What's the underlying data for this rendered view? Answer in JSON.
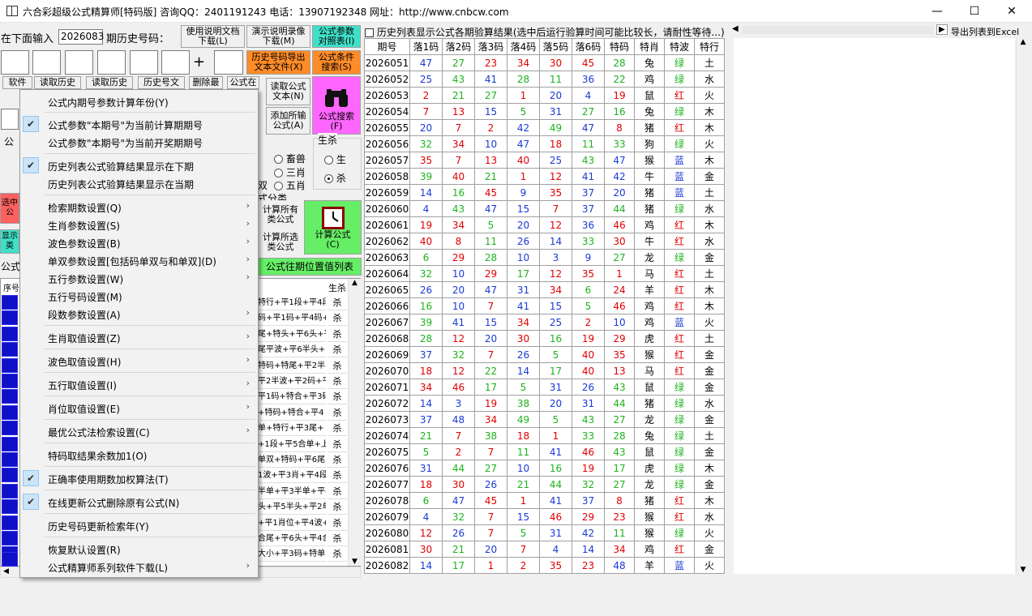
{
  "window": {
    "title": "六合彩超级公式精算师[特码版]  咨询QQ：2401191243 电话：13907192348 网址：http://www.cnbcw.com",
    "minimize": "—",
    "maximize": "☐",
    "close": "✕"
  },
  "toolbar": {
    "input_label": "在下面输入",
    "issue_value": "2026083",
    "history_label": "期历史号码：",
    "plus": "+",
    "btn_manual": "使用说明文档\n下载(L)",
    "btn_video": "演示说明录像\n下载(M)",
    "btn_compare": "公式参数\n对照表(I)",
    "btn_export_text": "历史号码导出\n文本文件(X)",
    "btn_cond_search": "公式条件\n搜索(S)",
    "btn_read_formula": "读取公式\n文本(N)",
    "btn_add_all": "添加所输\n公式(A)",
    "btn_formula_search": "公式搜索\n(F)",
    "tab_software": "软件",
    "tab_read_history": "读取历史",
    "tab_read_history2": "读取历史",
    "tab_history_text": "历史号文",
    "tab_delete": "删除最",
    "tab_formula": "公式在"
  },
  "left": {
    "shengxiao_label": "生杀",
    "radio_sheng": "生",
    "radio_sha": "杀",
    "opt_chuzhu": "畜兽",
    "opt_sanxiao": "三肖",
    "opt_wuxiao": "五肖",
    "shuang": "双",
    "formula_class": "式分类",
    "btn_calc_all": "计算所有\n类公式",
    "btn_calc_sel": "计算所选\n类公式",
    "btn_calc": "计算公式\n(C)",
    "btn_position": "公式往期位置值列表",
    "xuhao": "序号",
    "shengsha": "生杀",
    "partial_a": "公",
    "partial_b": "选中\n公",
    "partial_c": "显示\n类",
    "partial_d": "公式",
    "rows": [
      "特行+平1段+平4段",
      "码+平1码+平4码+",
      "尾+特头+平6头+平",
      "尾平波+平6半头+",
      "特码+特尾+平2半",
      "平2半波+平2码+平",
      "平1码+特合+平3码",
      "+特码+特合+平4",
      "单+特行+平3尾+",
      "+1段+平5合单+上",
      "单双+特码+平6尾",
      "1波+平3肖+平4段",
      "半单+平3半单+平4",
      "头+平5半头+平2单",
      "+平1肖位+平4波+",
      "合尾+平6头+平4合",
      "大小+平3码+特单"
    ],
    "row_mark": "杀"
  },
  "right": {
    "checkbox_label": "历史列表显示公式各期验算结果(选中后运行验算时间可能比较长，请耐性等待...)",
    "export_excel": "导出列表到Excel"
  },
  "menu": {
    "items": [
      {
        "label": "公式内期号参数计算年份(Y)",
        "checked": false,
        "sub": false
      },
      {
        "label": "公式参数\"本期号\"为当前计算期期号",
        "checked": true,
        "sub": false
      },
      {
        "label": "公式参数\"本期号\"为当前开奖期期号",
        "checked": false,
        "sub": false
      },
      {
        "label": "历史列表公式验算结果显示在下期",
        "checked": true,
        "sub": false
      },
      {
        "label": "历史列表公式验算结果显示在当期",
        "checked": false,
        "sub": false
      },
      {
        "label": "检索期数设置(Q)",
        "checked": false,
        "sub": true
      },
      {
        "label": "生肖参数设置(S)",
        "checked": false,
        "sub": true
      },
      {
        "label": "波色参数设置(B)",
        "checked": false,
        "sub": true
      },
      {
        "label": "单双参数设置[包括码单双与和单双](D)",
        "checked": false,
        "sub": true
      },
      {
        "label": "五行参数设置(W)",
        "checked": false,
        "sub": true
      },
      {
        "label": "五行号码设置(M)",
        "checked": false,
        "sub": false
      },
      {
        "label": "段数参数设置(A)",
        "checked": false,
        "sub": true
      },
      {
        "label": "生肖取值设置(Z)",
        "checked": false,
        "sub": true
      },
      {
        "label": "波色取值设置(H)",
        "checked": false,
        "sub": true
      },
      {
        "label": "五行取值设置(I)",
        "checked": false,
        "sub": true
      },
      {
        "label": "肖位取值设置(E)",
        "checked": false,
        "sub": true
      },
      {
        "label": "最优公式法检索设置(C)",
        "checked": false,
        "sub": true
      },
      {
        "label": "特码取结果余数加1(O)",
        "checked": false,
        "sub": false
      },
      {
        "label": "正确率使用期数加权算法(T)",
        "checked": true,
        "sub": false
      },
      {
        "label": "在线更新公式删除原有公式(N)",
        "checked": true,
        "sub": false
      },
      {
        "label": "历史号码更新检索年(Y)",
        "checked": false,
        "sub": false
      },
      {
        "label": "恢复默认设置(R)",
        "checked": false,
        "sub": false
      },
      {
        "label": "公式精算师系列软件下载(L)",
        "checked": false,
        "sub": true
      }
    ]
  },
  "table": {
    "headers": [
      "期号",
      "落1码",
      "落2码",
      "落3码",
      "落4码",
      "落5码",
      "落6码",
      "特码",
      "特肖",
      "特波",
      "特行"
    ],
    "colors": {
      "red": "#e00000",
      "green": "#1db31d",
      "blue": "#1a3ad6"
    },
    "rows": [
      [
        "2026051",
        [
          47,
          "b"
        ],
        [
          27,
          "g"
        ],
        [
          23,
          "r"
        ],
        [
          34,
          "r"
        ],
        [
          30,
          "r"
        ],
        [
          45,
          "r"
        ],
        [
          28,
          "g"
        ],
        "兔",
        [
          "绿",
          "g"
        ],
        "土"
      ],
      [
        "2026052",
        [
          25,
          "b"
        ],
        [
          43,
          "g"
        ],
        [
          41,
          "b"
        ],
        [
          28,
          "g"
        ],
        [
          11,
          "g"
        ],
        [
          36,
          "b"
        ],
        [
          22,
          "g"
        ],
        "鸡",
        [
          "绿",
          "g"
        ],
        "水"
      ],
      [
        "2026053",
        [
          2,
          "r"
        ],
        [
          21,
          "g"
        ],
        [
          27,
          "g"
        ],
        [
          1,
          "r"
        ],
        [
          20,
          "b"
        ],
        [
          4,
          "b"
        ],
        [
          19,
          "r"
        ],
        "鼠",
        [
          "红",
          "r"
        ],
        "火"
      ],
      [
        "2026054",
        [
          7,
          "r"
        ],
        [
          13,
          "r"
        ],
        [
          15,
          "b"
        ],
        [
          5,
          "g"
        ],
        [
          31,
          "b"
        ],
        [
          27,
          "g"
        ],
        [
          16,
          "g"
        ],
        "兔",
        [
          "绿",
          "g"
        ],
        "木"
      ],
      [
        "2026055",
        [
          20,
          "b"
        ],
        [
          7,
          "r"
        ],
        [
          2,
          "r"
        ],
        [
          42,
          "b"
        ],
        [
          49,
          "g"
        ],
        [
          47,
          "b"
        ],
        [
          8,
          "r"
        ],
        "猪",
        [
          "红",
          "r"
        ],
        "木"
      ],
      [
        "2026056",
        [
          32,
          "g"
        ],
        [
          34,
          "r"
        ],
        [
          10,
          "b"
        ],
        [
          47,
          "b"
        ],
        [
          18,
          "r"
        ],
        [
          11,
          "g"
        ],
        [
          33,
          "g"
        ],
        "狗",
        [
          "绿",
          "g"
        ],
        "火"
      ],
      [
        "2026057",
        [
          35,
          "r"
        ],
        [
          7,
          "r"
        ],
        [
          13,
          "r"
        ],
        [
          40,
          "r"
        ],
        [
          25,
          "b"
        ],
        [
          43,
          "g"
        ],
        [
          47,
          "b"
        ],
        "猴",
        [
          "蓝",
          "b"
        ],
        "木"
      ],
      [
        "2026058",
        [
          39,
          "g"
        ],
        [
          40,
          "r"
        ],
        [
          21,
          "g"
        ],
        [
          1,
          "r"
        ],
        [
          12,
          "r"
        ],
        [
          41,
          "b"
        ],
        [
          42,
          "b"
        ],
        "牛",
        [
          "蓝",
          "b"
        ],
        "金"
      ],
      [
        "2026059",
        [
          14,
          "b"
        ],
        [
          16,
          "g"
        ],
        [
          45,
          "r"
        ],
        [
          9,
          "b"
        ],
        [
          35,
          "r"
        ],
        [
          37,
          "b"
        ],
        [
          20,
          "b"
        ],
        "猪",
        [
          "蓝",
          "b"
        ],
        "土"
      ],
      [
        "2026060",
        [
          4,
          "b"
        ],
        [
          43,
          "g"
        ],
        [
          47,
          "b"
        ],
        [
          15,
          "b"
        ],
        [
          7,
          "r"
        ],
        [
          37,
          "b"
        ],
        [
          44,
          "g"
        ],
        "猪",
        [
          "绿",
          "g"
        ],
        "水"
      ],
      [
        "2026061",
        [
          19,
          "r"
        ],
        [
          34,
          "r"
        ],
        [
          5,
          "g"
        ],
        [
          20,
          "b"
        ],
        [
          12,
          "r"
        ],
        [
          36,
          "b"
        ],
        [
          46,
          "r"
        ],
        "鸡",
        [
          "红",
          "r"
        ],
        "木"
      ],
      [
        "2026062",
        [
          40,
          "r"
        ],
        [
          8,
          "r"
        ],
        [
          11,
          "g"
        ],
        [
          26,
          "b"
        ],
        [
          14,
          "b"
        ],
        [
          33,
          "g"
        ],
        [
          30,
          "r"
        ],
        "牛",
        [
          "红",
          "r"
        ],
        "水"
      ],
      [
        "2026063",
        [
          6,
          "g"
        ],
        [
          29,
          "r"
        ],
        [
          28,
          "g"
        ],
        [
          10,
          "b"
        ],
        [
          3,
          "b"
        ],
        [
          9,
          "b"
        ],
        [
          27,
          "g"
        ],
        "龙",
        [
          "绿",
          "g"
        ],
        "金"
      ],
      [
        "2026064",
        [
          32,
          "g"
        ],
        [
          10,
          "b"
        ],
        [
          29,
          "r"
        ],
        [
          17,
          "g"
        ],
        [
          12,
          "r"
        ],
        [
          35,
          "r"
        ],
        [
          1,
          "r"
        ],
        "马",
        [
          "红",
          "r"
        ],
        "土"
      ],
      [
        "2026065",
        [
          26,
          "b"
        ],
        [
          20,
          "b"
        ],
        [
          47,
          "b"
        ],
        [
          31,
          "b"
        ],
        [
          34,
          "r"
        ],
        [
          6,
          "g"
        ],
        [
          24,
          "r"
        ],
        "羊",
        [
          "红",
          "r"
        ],
        "木"
      ],
      [
        "2026066",
        [
          16,
          "g"
        ],
        [
          10,
          "b"
        ],
        [
          7,
          "r"
        ],
        [
          41,
          "b"
        ],
        [
          15,
          "b"
        ],
        [
          5,
          "g"
        ],
        [
          46,
          "r"
        ],
        "鸡",
        [
          "红",
          "r"
        ],
        "木"
      ],
      [
        "2026067",
        [
          39,
          "g"
        ],
        [
          41,
          "b"
        ],
        [
          15,
          "b"
        ],
        [
          34,
          "r"
        ],
        [
          25,
          "b"
        ],
        [
          2,
          "r"
        ],
        [
          10,
          "b"
        ],
        "鸡",
        [
          "蓝",
          "b"
        ],
        "火"
      ],
      [
        "2026068",
        [
          28,
          "g"
        ],
        [
          12,
          "r"
        ],
        [
          20,
          "b"
        ],
        [
          30,
          "r"
        ],
        [
          16,
          "g"
        ],
        [
          19,
          "r"
        ],
        [
          29,
          "r"
        ],
        "虎",
        [
          "红",
          "r"
        ],
        "土"
      ],
      [
        "2026069",
        [
          37,
          "b"
        ],
        [
          32,
          "g"
        ],
        [
          7,
          "r"
        ],
        [
          26,
          "b"
        ],
        [
          5,
          "g"
        ],
        [
          40,
          "r"
        ],
        [
          35,
          "r"
        ],
        "猴",
        [
          "红",
          "r"
        ],
        "金"
      ],
      [
        "2026070",
        [
          18,
          "r"
        ],
        [
          12,
          "r"
        ],
        [
          22,
          "g"
        ],
        [
          14,
          "b"
        ],
        [
          17,
          "g"
        ],
        [
          40,
          "r"
        ],
        [
          13,
          "r"
        ],
        "马",
        [
          "红",
          "r"
        ],
        "金"
      ],
      [
        "2026071",
        [
          34,
          "r"
        ],
        [
          46,
          "r"
        ],
        [
          17,
          "g"
        ],
        [
          5,
          "g"
        ],
        [
          31,
          "b"
        ],
        [
          26,
          "b"
        ],
        [
          43,
          "g"
        ],
        "鼠",
        [
          "绿",
          "g"
        ],
        "金"
      ],
      [
        "2026072",
        [
          14,
          "b"
        ],
        [
          3,
          "b"
        ],
        [
          19,
          "r"
        ],
        [
          38,
          "g"
        ],
        [
          20,
          "b"
        ],
        [
          31,
          "b"
        ],
        [
          44,
          "g"
        ],
        "猪",
        [
          "绿",
          "g"
        ],
        "水"
      ],
      [
        "2026073",
        [
          37,
          "b"
        ],
        [
          48,
          "b"
        ],
        [
          34,
          "r"
        ],
        [
          49,
          "g"
        ],
        [
          5,
          "g"
        ],
        [
          43,
          "g"
        ],
        [
          27,
          "g"
        ],
        "龙",
        [
          "绿",
          "g"
        ],
        "金"
      ],
      [
        "2026074",
        [
          21,
          "g"
        ],
        [
          7,
          "r"
        ],
        [
          38,
          "g"
        ],
        [
          18,
          "r"
        ],
        [
          1,
          "r"
        ],
        [
          33,
          "g"
        ],
        [
          28,
          "g"
        ],
        "兔",
        [
          "绿",
          "g"
        ],
        "土"
      ],
      [
        "2026075",
        [
          5,
          "g"
        ],
        [
          2,
          "r"
        ],
        [
          7,
          "r"
        ],
        [
          11,
          "g"
        ],
        [
          41,
          "b"
        ],
        [
          46,
          "r"
        ],
        [
          43,
          "g"
        ],
        "鼠",
        [
          "绿",
          "g"
        ],
        "金"
      ],
      [
        "2026076",
        [
          31,
          "b"
        ],
        [
          44,
          "g"
        ],
        [
          27,
          "g"
        ],
        [
          10,
          "b"
        ],
        [
          16,
          "g"
        ],
        [
          19,
          "r"
        ],
        [
          17,
          "g"
        ],
        "虎",
        [
          "绿",
          "g"
        ],
        "木"
      ],
      [
        "2026077",
        [
          18,
          "r"
        ],
        [
          30,
          "r"
        ],
        [
          26,
          "b"
        ],
        [
          21,
          "g"
        ],
        [
          44,
          "g"
        ],
        [
          32,
          "g"
        ],
        [
          27,
          "g"
        ],
        "龙",
        [
          "绿",
          "g"
        ],
        "金"
      ],
      [
        "2026078",
        [
          6,
          "g"
        ],
        [
          47,
          "b"
        ],
        [
          45,
          "r"
        ],
        [
          1,
          "r"
        ],
        [
          41,
          "b"
        ],
        [
          37,
          "b"
        ],
        [
          8,
          "r"
        ],
        "猪",
        [
          "红",
          "r"
        ],
        "木"
      ],
      [
        "2026079",
        [
          4,
          "b"
        ],
        [
          32,
          "g"
        ],
        [
          7,
          "r"
        ],
        [
          15,
          "b"
        ],
        [
          46,
          "r"
        ],
        [
          29,
          "r"
        ],
        [
          23,
          "r"
        ],
        "猴",
        [
          "红",
          "r"
        ],
        "水"
      ],
      [
        "2026080",
        [
          12,
          "r"
        ],
        [
          26,
          "b"
        ],
        [
          7,
          "r"
        ],
        [
          5,
          "g"
        ],
        [
          31,
          "b"
        ],
        [
          42,
          "b"
        ],
        [
          11,
          "g"
        ],
        "猴",
        [
          "绿",
          "g"
        ],
        "火"
      ],
      [
        "2026081",
        [
          30,
          "r"
        ],
        [
          21,
          "g"
        ],
        [
          20,
          "b"
        ],
        [
          7,
          "r"
        ],
        [
          4,
          "b"
        ],
        [
          14,
          "b"
        ],
        [
          34,
          "r"
        ],
        "鸡",
        [
          "红",
          "r"
        ],
        "金"
      ],
      [
        "2026082",
        [
          14,
          "b"
        ],
        [
          17,
          "g"
        ],
        [
          1,
          "r"
        ],
        [
          2,
          "r"
        ],
        [
          35,
          "r"
        ],
        [
          23,
          "r"
        ],
        [
          48,
          "b"
        ],
        "羊",
        [
          "蓝",
          "b"
        ],
        "火"
      ]
    ]
  }
}
